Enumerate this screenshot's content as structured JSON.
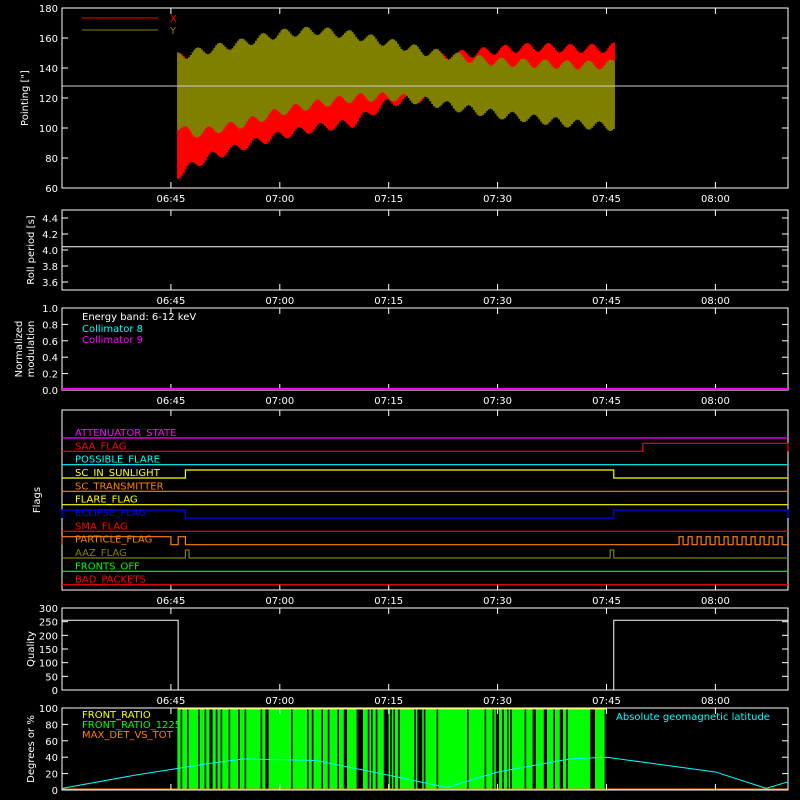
{
  "colors": {
    "background": "#000000",
    "axes": "#ffffff",
    "x_series": "#ff0000",
    "y_series": "#808000",
    "cyan": "#00ffff",
    "magenta": "#ff00ff",
    "green": "#00ff00",
    "orange": "#ff8000",
    "yellow": "#ffff00",
    "blue": "#0000ff",
    "red": "#ff0000"
  },
  "time_ticks": [
    "06:45",
    "07:00",
    "07:15",
    "07:30",
    "07:45",
    "08:00"
  ],
  "chart_data": [
    {
      "id": "pointing",
      "type": "area",
      "ylabel": "Pointing [\"]",
      "ylim": [
        60,
        180
      ],
      "yticks": [
        60,
        80,
        100,
        120,
        140,
        160,
        180
      ],
      "xlim": [
        "06:30",
        "08:10"
      ],
      "reference_line": 128,
      "legend_placement": "top-left",
      "series": [
        {
          "name": "X",
          "color": "#ff0000",
          "x": [
            "06:46",
            "06:48",
            "06:50",
            "06:55",
            "07:00",
            "07:05",
            "07:10",
            "07:15",
            "07:20",
            "07:25",
            "07:30",
            "07:35",
            "07:40",
            "07:45",
            "07:46"
          ],
          "low": [
            66,
            72,
            77,
            85,
            92,
            97,
            100,
            114,
            117,
            116,
            114,
            112,
            110,
            108,
            106
          ],
          "high": [
            150,
            150,
            152,
            155,
            158,
            155,
            145,
            146,
            149,
            152,
            155,
            157,
            156,
            156,
            157
          ]
        },
        {
          "name": "Y",
          "color": "#808000",
          "x": [
            "06:46",
            "06:48",
            "06:50",
            "06:55",
            "07:00",
            "07:05",
            "07:10",
            "07:15",
            "07:20",
            "07:25",
            "07:30",
            "07:35",
            "07:40",
            "07:45",
            "07:46"
          ],
          "low": [
            98,
            93,
            95,
            100,
            108,
            113,
            117,
            118,
            115,
            110,
            106,
            103,
            100,
            98,
            98
          ],
          "high": [
            151,
            153,
            155,
            160,
            166,
            168,
            165,
            160,
            154,
            150,
            147,
            146,
            145,
            145,
            146
          ]
        }
      ]
    },
    {
      "id": "roll_period",
      "type": "line",
      "ylabel": "Roll period [s]",
      "ylim": [
        3.5,
        4.5
      ],
      "yticks": [
        "3.6",
        "3.8",
        "4.0",
        "4.2",
        "4.4"
      ],
      "series": [
        {
          "name": "",
          "x": [
            "06:30",
            "08:10"
          ],
          "values": [
            4.04,
            4.04
          ]
        }
      ]
    },
    {
      "id": "modulation",
      "type": "line",
      "ylabel": "Normalized modulation",
      "ylabel_lines": [
        "Normalized",
        "modulation"
      ],
      "ylim": [
        0,
        1
      ],
      "yticks": [
        "0.0",
        "0.2",
        "0.4",
        "0.6",
        "0.8",
        "1.0"
      ],
      "annotation": "Energy band: 6-12 keV",
      "series": [
        {
          "name": "Collimator 8",
          "color": "#00ffff",
          "values": []
        },
        {
          "name": "Collimator 9",
          "color": "#ff00ff",
          "values": [
            0,
            0
          ]
        }
      ]
    },
    {
      "id": "flags",
      "type": "line",
      "ylabel": "Flags",
      "flags": [
        {
          "name": "ATTENUATOR_STATE",
          "color": "#ff00ff",
          "high": []
        },
        {
          "name": "SAA_FLAG",
          "color": "#ff0000",
          "high": [
            [
              "07:50",
              "08:10"
            ]
          ]
        },
        {
          "name": "POSSIBLE_FLARE",
          "color": "#00ffff",
          "high": []
        },
        {
          "name": "SC_IN_SUNLIGHT",
          "color": "#ffff00",
          "high": [
            [
              "06:47",
              "07:46"
            ]
          ]
        },
        {
          "name": "SC_TRANSMITTER",
          "color": "#ff8000",
          "high": []
        },
        {
          "name": "FLARE_FLAG",
          "color": "#ffff00",
          "high": []
        },
        {
          "name": "ECLIPSE_FLAG",
          "color": "#0000ff",
          "high": [
            [
              "06:30",
              "06:47"
            ],
            [
              "07:46",
              "08:10"
            ]
          ]
        },
        {
          "name": "SMA_FLAG",
          "color": "#ff0000",
          "high": []
        },
        {
          "name": "PARTICLE_FLAG",
          "color": "#ff8000",
          "high": [
            [
              "06:30",
              "06:45"
            ],
            [
              "06:46",
              "06:47"
            ]
          ],
          "pulses_after": "07:55"
        },
        {
          "name": "AAZ_FLAG",
          "color": "#808000",
          "high": [
            [
              "06:47",
              "06:47.5"
            ],
            [
              "07:45.5",
              "07:46"
            ]
          ]
        },
        {
          "name": "FRONTS_OFF",
          "color": "#00ff00",
          "high": []
        },
        {
          "name": "BAD_PACKETS",
          "color": "#ff0000",
          "high": []
        }
      ]
    },
    {
      "id": "quality",
      "type": "line",
      "ylabel": "Quality",
      "ylim": [
        0,
        300
      ],
      "yticks": [
        0,
        50,
        100,
        150,
        200,
        250,
        300
      ],
      "series": [
        {
          "name": "",
          "x": [
            "06:30",
            "06:46",
            "06:46",
            "07:46",
            "07:46",
            "08:10"
          ],
          "values": [
            255,
            255,
            0,
            0,
            255,
            255
          ]
        }
      ]
    },
    {
      "id": "geomagnetic",
      "type": "line",
      "ylabel": "Degrees or %",
      "ylim": [
        0,
        100
      ],
      "yticks": [
        0,
        20,
        40,
        60,
        80,
        100
      ],
      "legend": [
        "FRONT_RATIO",
        "FRONT_RATIO_1225",
        "MAX_DET_VS_TOT"
      ],
      "legend_colors": [
        "#ffff00",
        "#00ff00",
        "#ff8000"
      ],
      "right_label": "Absolute geomagnetic latitude",
      "series": [
        {
          "name": "Absolute geomagnetic latitude",
          "color": "#00ffff",
          "x": [
            "06:30",
            "06:40",
            "06:50",
            "06:55",
            "07:05",
            "07:15",
            "07:23",
            "07:30",
            "07:40",
            "07:45",
            "08:00",
            "08:07",
            "08:10"
          ],
          "values": [
            2,
            18,
            32,
            38,
            36,
            18,
            3,
            22,
            38,
            40,
            22,
            2,
            10
          ]
        },
        {
          "name": "FRONT_RATIO_1225",
          "color": "#00ff00",
          "fill_range": [
            "06:46",
            "07:45"
          ],
          "level": 100
        }
      ]
    }
  ]
}
